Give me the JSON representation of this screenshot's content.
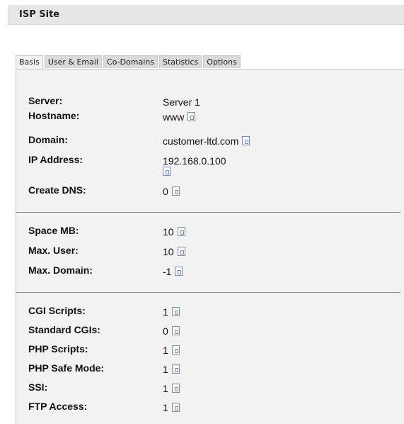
{
  "header": {
    "title": "ISP Site"
  },
  "tabs": [
    {
      "label": "Basis",
      "active": true
    },
    {
      "label": "User & Email",
      "active": false
    },
    {
      "label": "Co-Domains",
      "active": false
    },
    {
      "label": "Statistics",
      "active": false
    },
    {
      "label": "Options",
      "active": false
    }
  ],
  "section1": {
    "server": {
      "label": "Server:",
      "value": "Server 1"
    },
    "hostname": {
      "label": "Hostname:",
      "value": "www"
    },
    "domain": {
      "label": "Domain:",
      "value": "customer-ltd.com"
    },
    "ip": {
      "label": "IP Address:",
      "value": "192.168.0.100"
    },
    "create_dns": {
      "label": "Create DNS:",
      "value": "0"
    }
  },
  "section2": {
    "space": {
      "label": "Space MB:",
      "value": "10"
    },
    "max_user": {
      "label": "Max. User:",
      "value": "10"
    },
    "max_domain": {
      "label": "Max. Domain:",
      "value": "-1"
    }
  },
  "section3": {
    "cgi": {
      "label": "CGI Scripts:",
      "value": "1"
    },
    "std_cgi": {
      "label": "Standard CGIs:",
      "value": "0"
    },
    "php": {
      "label": "PHP Scripts:",
      "value": "1"
    },
    "php_safe": {
      "label": "PHP Safe Mode:",
      "value": "1"
    },
    "ssi": {
      "label": "SSI:",
      "value": "1"
    },
    "ftp": {
      "label": "FTP Access:",
      "value": "1"
    }
  },
  "icons": {
    "help": "document-icon"
  },
  "colors": {
    "tab_active": "#f2f2f2",
    "tab_inactive": "#dadada",
    "panel_bg": "#f2f2f2",
    "title_bar": "#e6e6e6"
  }
}
